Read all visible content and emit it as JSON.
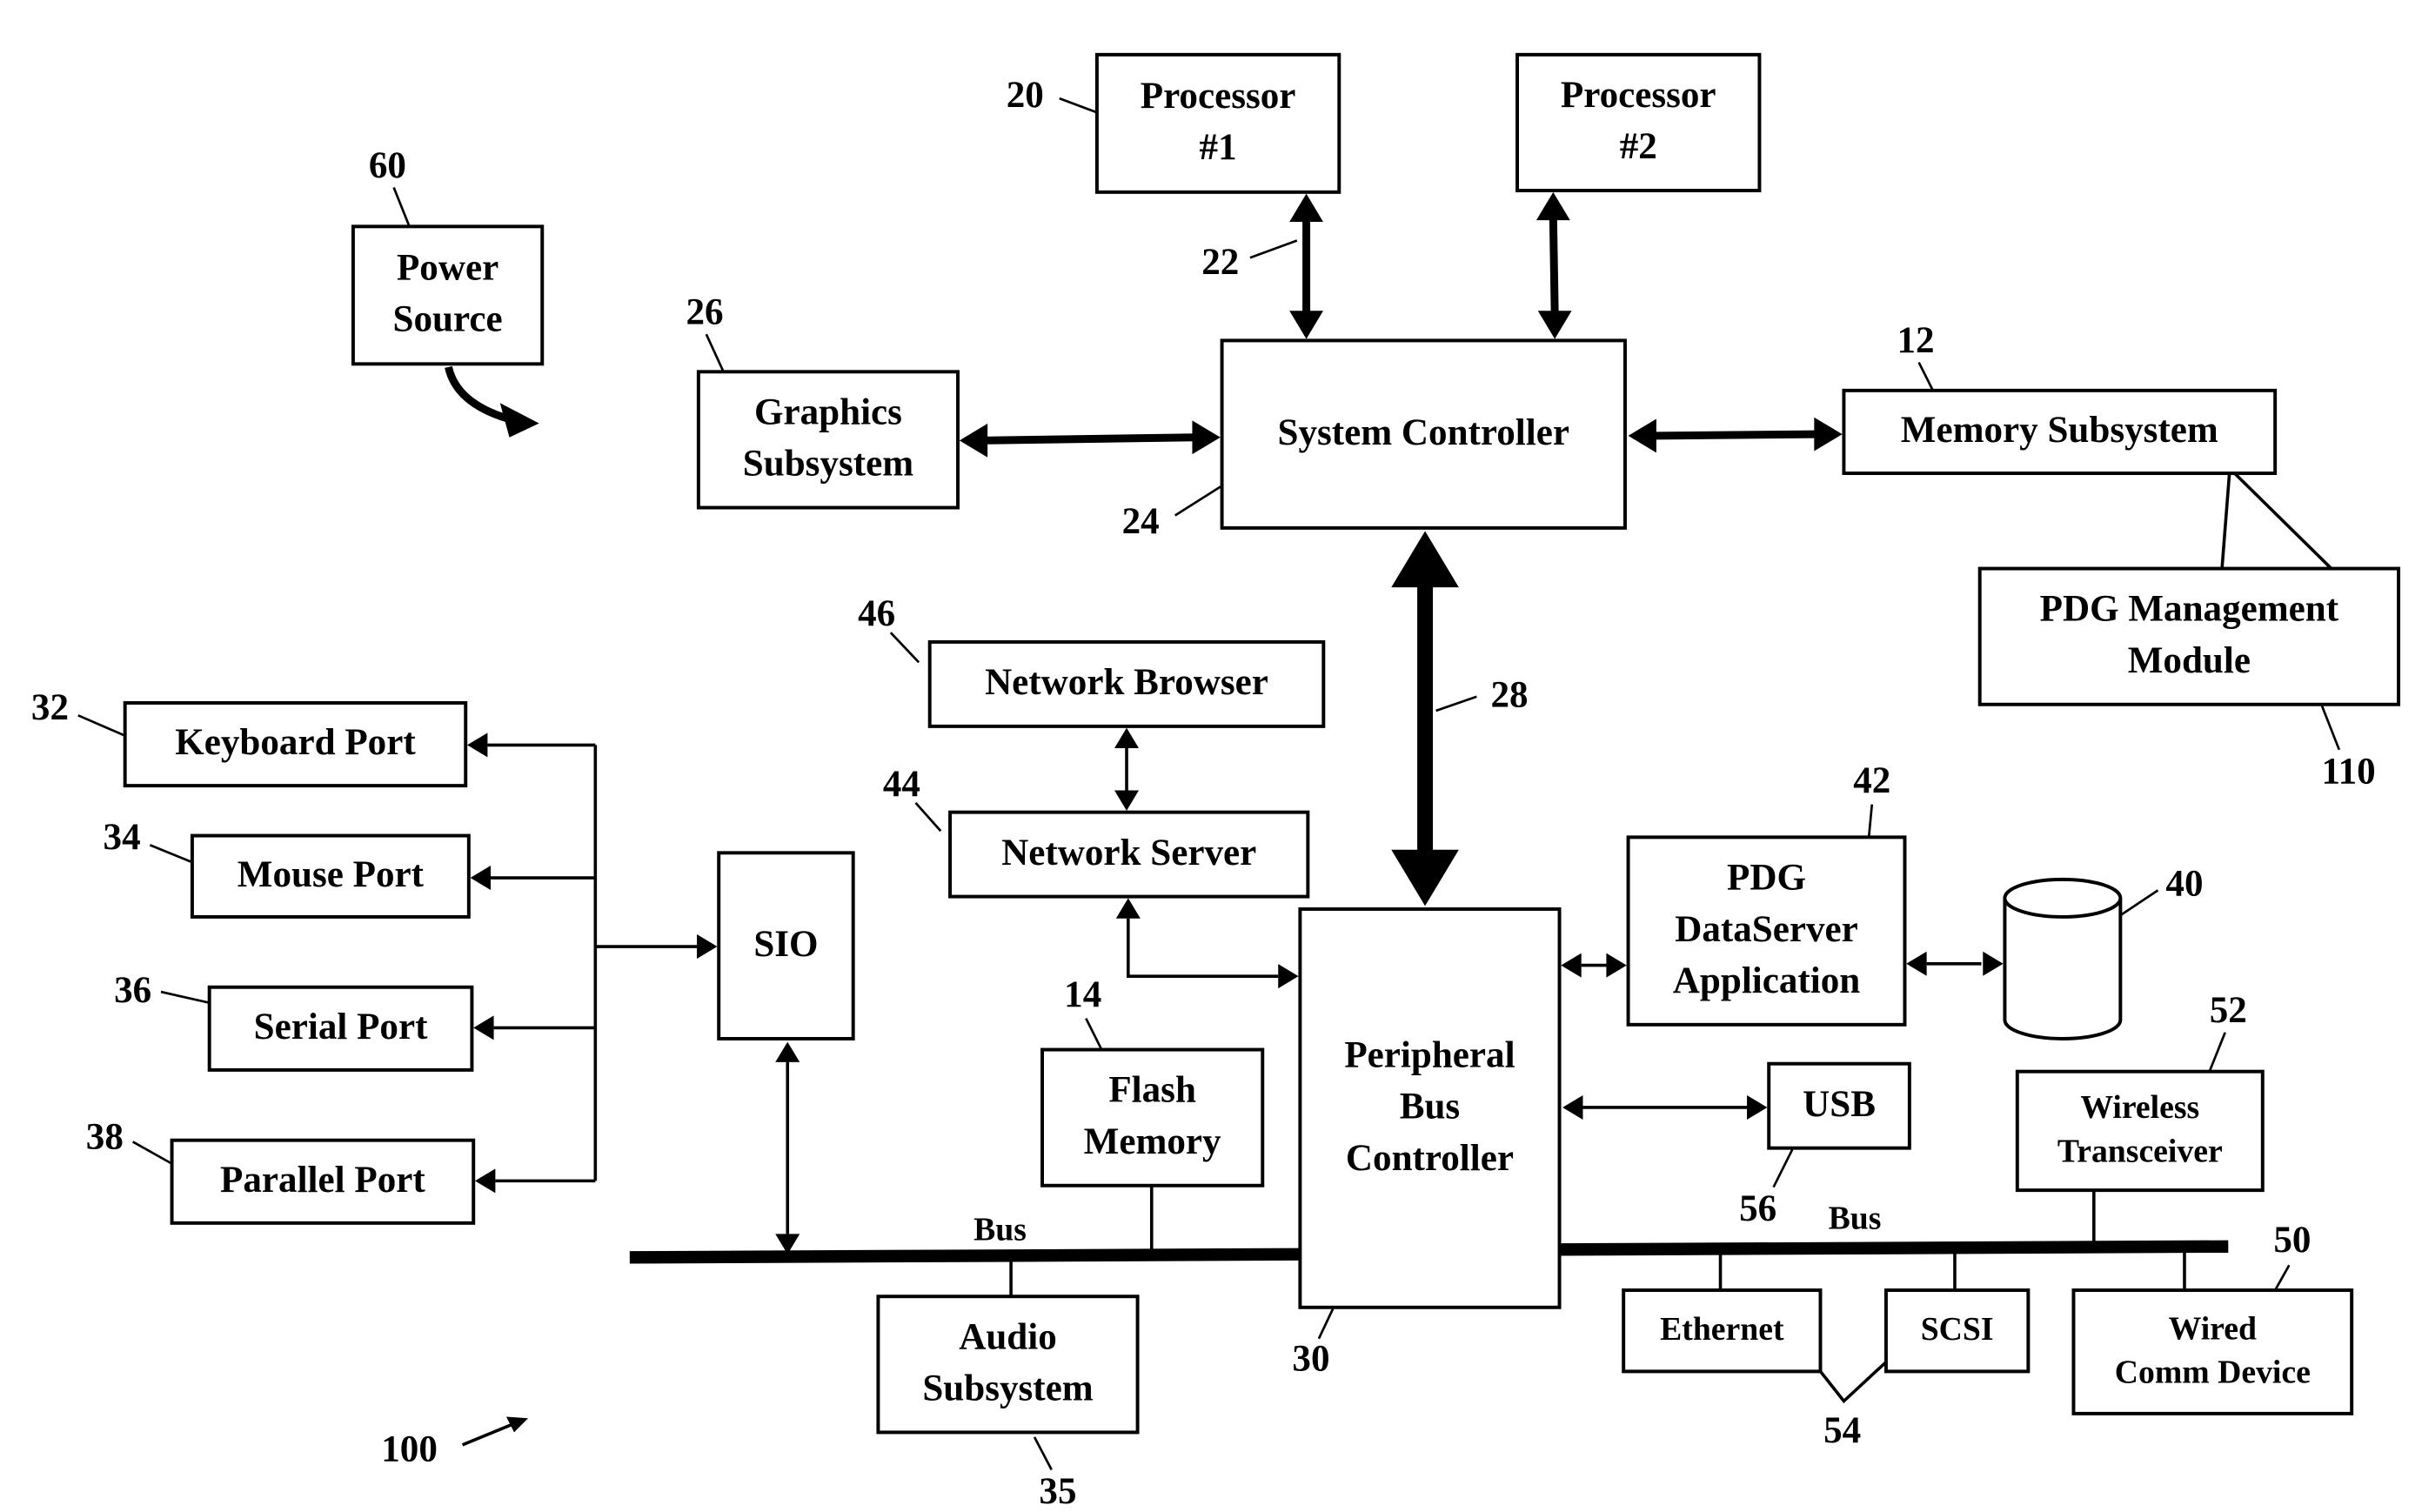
{
  "figure": {
    "reference": "100",
    "colors": {
      "ink": "#000000",
      "paper": "#ffffff"
    }
  },
  "components": [
    {
      "id": "power-source",
      "ref": "60",
      "lines": [
        "Power",
        "Source"
      ]
    },
    {
      "id": "processor-1",
      "ref": "20",
      "lines": [
        "Processor",
        "#1"
      ]
    },
    {
      "id": "processor-2",
      "ref": "",
      "lines": [
        "Processor",
        "#2"
      ]
    },
    {
      "id": "graphics-subsystem",
      "ref": "26",
      "lines": [
        "Graphics",
        "Subsystem"
      ]
    },
    {
      "id": "system-controller",
      "ref": "24",
      "lines": [
        "System Controller"
      ]
    },
    {
      "id": "memory-subsystem",
      "ref": "12",
      "lines": [
        "Memory Subsystem"
      ]
    },
    {
      "id": "pdg-management-module",
      "ref": "110",
      "lines": [
        "PDG Management",
        "Module"
      ]
    },
    {
      "id": "network-browser",
      "ref": "46",
      "lines": [
        "Network Browser"
      ]
    },
    {
      "id": "network-server",
      "ref": "44",
      "lines": [
        "Network Server"
      ]
    },
    {
      "id": "keyboard-port",
      "ref": "32",
      "lines": [
        "Keyboard Port"
      ]
    },
    {
      "id": "mouse-port",
      "ref": "34",
      "lines": [
        "Mouse Port"
      ]
    },
    {
      "id": "serial-port",
      "ref": "36",
      "lines": [
        "Serial Port"
      ]
    },
    {
      "id": "parallel-port",
      "ref": "38",
      "lines": [
        "Parallel Port"
      ]
    },
    {
      "id": "sio",
      "ref": "",
      "lines": [
        "SIO"
      ]
    },
    {
      "id": "flash-memory",
      "ref": "14",
      "lines": [
        "Flash",
        "Memory"
      ]
    },
    {
      "id": "peripheral-bus-controller",
      "ref": "30",
      "lines": [
        "Peripheral",
        "Bus",
        "Controller"
      ]
    },
    {
      "id": "pdg-dataserver-application",
      "ref": "42",
      "lines": [
        "PDG",
        "DataServer",
        "Application"
      ]
    },
    {
      "id": "database",
      "ref": "40",
      "lines": []
    },
    {
      "id": "usb",
      "ref": "56",
      "lines": [
        "USB"
      ]
    },
    {
      "id": "wireless-transceiver",
      "ref": "52",
      "lines": [
        "Wireless",
        "Transceiver"
      ]
    },
    {
      "id": "audio-subsystem",
      "ref": "35",
      "lines": [
        "Audio",
        "Subsystem"
      ]
    },
    {
      "id": "ethernet",
      "ref": "",
      "lines": [
        "Ethernet"
      ]
    },
    {
      "id": "scsi",
      "ref": "",
      "lines": [
        "SCSI"
      ]
    },
    {
      "id": "wired-comm-device",
      "ref": "50",
      "lines": [
        "Wired",
        "Comm Device"
      ]
    }
  ],
  "connections": {
    "processor_bus_ref": "22",
    "main_bus_ref": "28",
    "ethernet_scsi_group_ref": "54"
  },
  "buses": [
    {
      "id": "left-bus",
      "label": "Bus"
    },
    {
      "id": "right-bus",
      "label": "Bus"
    }
  ]
}
